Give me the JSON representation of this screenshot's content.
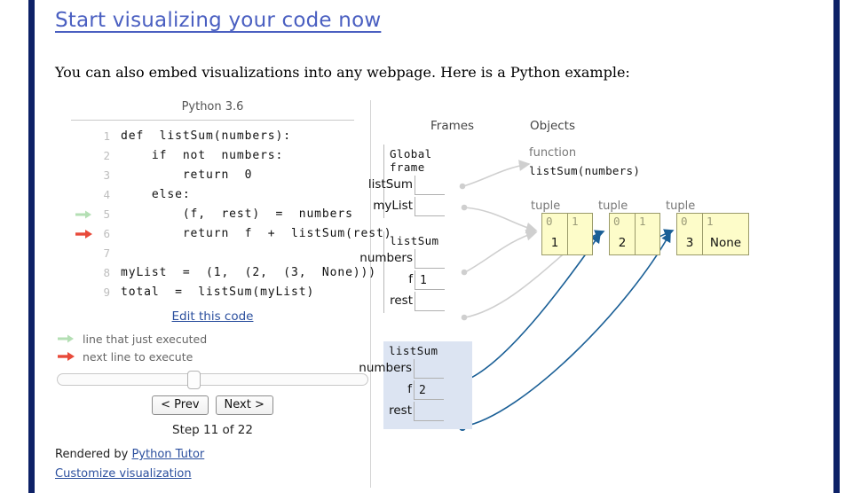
{
  "page": {
    "title": "Start visualizing your code now",
    "intro": "You can also embed visualizations into any webpage. Here is a Python example:"
  },
  "code_panel": {
    "python_version": "Python 3.6",
    "lines": [
      {
        "no": "1",
        "text": "def  listSum(numbers):",
        "arrow": "none"
      },
      {
        "no": "2",
        "text": "    if  not  numbers:",
        "arrow": "none"
      },
      {
        "no": "3",
        "text": "        return  0",
        "arrow": "none"
      },
      {
        "no": "4",
        "text": "    else:",
        "arrow": "none"
      },
      {
        "no": "5",
        "text": "        (f,  rest)  =  numbers",
        "arrow": "green"
      },
      {
        "no": "6",
        "text": "        return  f  +  listSum(rest)",
        "arrow": "red"
      },
      {
        "no": "7",
        "text": "",
        "arrow": "none"
      },
      {
        "no": "8",
        "text": "myList  =  (1,  (2,  (3,  None)))",
        "arrow": "none"
      },
      {
        "no": "9",
        "text": "total  =  listSum(myList)",
        "arrow": "none"
      }
    ],
    "edit_link": "Edit this code",
    "legend": [
      {
        "label": "line that just executed",
        "color": "#b4dfb4"
      },
      {
        "label": "next line to execute",
        "color": "#e84a3a"
      }
    ],
    "prev_button": "< Prev",
    "next_button": "Next >",
    "step_label": "Step 11 of 22",
    "rendered_by_prefix": "Rendered by ",
    "rendered_by_link": "Python Tutor",
    "customize_link": "Customize visualization",
    "slider_percent": 43
  },
  "viz": {
    "headers": {
      "frames": "Frames",
      "objects": "Objects"
    },
    "frames": [
      {
        "title": "Global frame",
        "active": false,
        "vars": [
          {
            "name": "listSum",
            "value": "",
            "pointer": true
          },
          {
            "name": "myList",
            "value": "",
            "pointer": true
          }
        ]
      },
      {
        "title": "listSum",
        "active": false,
        "vars": [
          {
            "name": "numbers",
            "value": "",
            "pointer": true
          },
          {
            "name": "f",
            "value": "1",
            "pointer": false
          },
          {
            "name": "rest",
            "value": "",
            "pointer": true
          }
        ]
      },
      {
        "title": "listSum",
        "active": true,
        "vars": [
          {
            "name": "numbers",
            "value": "",
            "pointer": true
          },
          {
            "name": "f",
            "value": "2",
            "pointer": false
          },
          {
            "name": "rest",
            "value": "",
            "pointer": true
          }
        ]
      }
    ],
    "objects": {
      "function": {
        "type_label": "function",
        "signature": "listSum(numbers)"
      },
      "tuples": [
        {
          "type_label": "tuple",
          "indices": [
            "0",
            "1"
          ],
          "values": [
            "1",
            ""
          ]
        },
        {
          "type_label": "tuple",
          "indices": [
            "0",
            "1"
          ],
          "values": [
            "2",
            ""
          ]
        },
        {
          "type_label": "tuple",
          "indices": [
            "0",
            "1"
          ],
          "values": [
            "3",
            "None"
          ]
        }
      ]
    },
    "colors": {
      "tuple_fill": "#fdfcc9",
      "tuple_border": "#9a9a6a",
      "active_frame_bg": "#dce4f2",
      "pointer_blue": "#1a5f96",
      "pointer_grey": "#cfcfcf",
      "accent_navy": "#0d2167"
    }
  }
}
